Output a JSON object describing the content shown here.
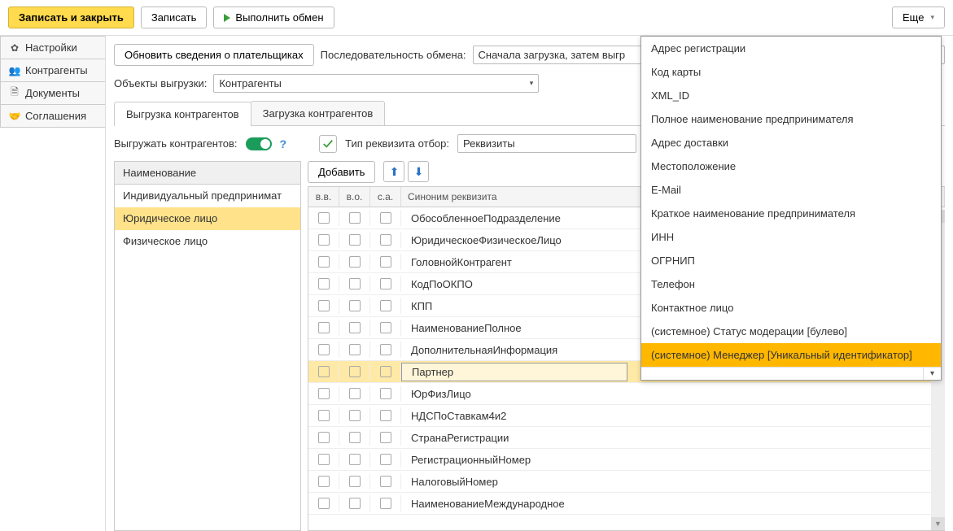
{
  "toolbar": {
    "save_close": "Записать и закрыть",
    "save": "Записать",
    "exchange": "Выполнить обмен",
    "more": "Еще"
  },
  "sidebar": {
    "items": [
      {
        "icon": "gear",
        "label": "Настройки"
      },
      {
        "icon": "users",
        "label": "Контрагенты"
      },
      {
        "icon": "doc",
        "label": "Документы"
      },
      {
        "icon": "hand",
        "label": "Соглашения"
      }
    ]
  },
  "content": {
    "update_payers": "Обновить сведения о плательщиках",
    "seq_label": "Последовательность обмена:",
    "seq_value": "Сначала загрузка, затем выгр",
    "export_objects_label": "Объекты выгрузки:",
    "export_objects_value": "Контрагенты",
    "tabs": [
      {
        "label": "Выгрузка контрагентов",
        "active": true
      },
      {
        "label": "Загрузка контрагентов",
        "active": false
      }
    ],
    "export_label": "Выгружать контрагентов:",
    "req_type_label": "Тип реквизита отбор:",
    "req_type_value": "Реквизиты",
    "left": {
      "header": "Наименование",
      "items": [
        {
          "label": "Индивидуальный предпринимат"
        },
        {
          "label": "Юридическое лицо",
          "selected": true
        },
        {
          "label": "Физическое лицо"
        }
      ]
    },
    "right": {
      "add": "Добавить",
      "headers": {
        "c1": "в.в.",
        "c2": "в.о.",
        "c3": "с.а.",
        "c4": "Синоним реквизита"
      },
      "rows": [
        {
          "name": "ОбособленноеПодразделение"
        },
        {
          "name": "ЮридическоеФизическоеЛицо"
        },
        {
          "name": "ГоловнойКонтрагент"
        },
        {
          "name": "КодПоОКПО"
        },
        {
          "name": "КПП"
        },
        {
          "name": "НаименованиеПолное"
        },
        {
          "name": "ДополнительнаяИнформация"
        },
        {
          "name": "Партнер",
          "highlight": true
        },
        {
          "name": "ЮрФизЛицо"
        },
        {
          "name": "НДСПоСтавкам4и2"
        },
        {
          "name": "СтранаРегистрации"
        },
        {
          "name": "РегистрационныйНомер"
        },
        {
          "name": "НалоговыйНомер"
        },
        {
          "name": "НаименованиеМеждународное"
        }
      ]
    }
  },
  "dropdown": {
    "items": [
      "Адрес регистрации",
      "Код карты",
      "XML_ID",
      "Полное наименование предпринимателя",
      "Адрес доставки",
      "Местоположение",
      "E-Mail",
      "Краткое наименование предпринимателя",
      "ИНН",
      "ОГРНИП",
      "Телефон",
      "Контактное лицо",
      "(системное) Статус модерации [булево]",
      "(системное) Менеджер [Уникальный идентификатор]"
    ],
    "selected_index": 13
  }
}
